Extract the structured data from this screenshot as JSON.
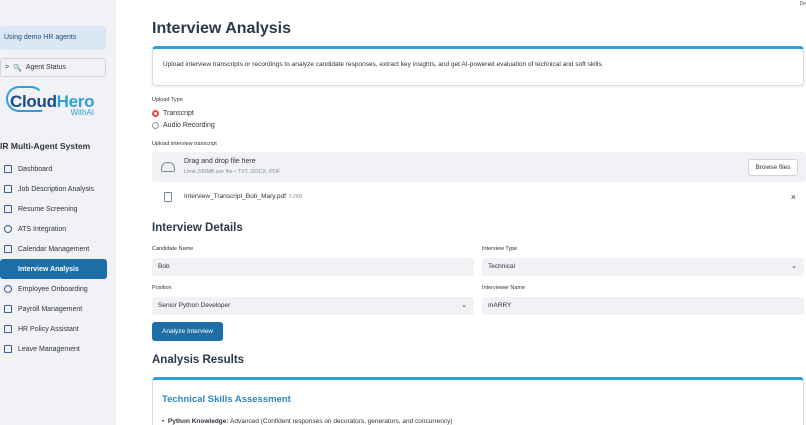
{
  "top_right": "De",
  "sidebar": {
    "demo_notice": "Using demo HR agents",
    "agent_status": {
      "chevron": ">",
      "label": "Agent Status"
    },
    "logo": {
      "brand_cloud": "Cloud",
      "brand_hero": "Hero",
      "brand_withai": "WithAI"
    },
    "system_title": "IR Multi-Agent System",
    "items": [
      {
        "label": "Dashboard",
        "icon": "home-icon",
        "active": false
      },
      {
        "label": "Job Description Analysis",
        "icon": "document-icon",
        "active": false
      },
      {
        "label": "Resume Screening",
        "icon": "resume-icon",
        "active": false
      },
      {
        "label": "ATS Integration",
        "icon": "gear-icon",
        "active": false
      },
      {
        "label": "Calendar Management",
        "icon": "calendar-icon",
        "active": false
      },
      {
        "label": "Interview Analysis",
        "icon": "interview-icon",
        "active": true
      },
      {
        "label": "Employee Onboarding",
        "icon": "user-add-icon",
        "active": false
      },
      {
        "label": "Payroll Management",
        "icon": "payroll-icon",
        "active": false
      },
      {
        "label": "HR Policy Assistant",
        "icon": "book-icon",
        "active": false
      },
      {
        "label": "Leave Management",
        "icon": "calendar-leave-icon",
        "active": false
      }
    ]
  },
  "main": {
    "title": "Interview Analysis",
    "intro": "Upload interview transcripts or recordings to analyze candidate responses, extract key insights, and get AI-powered evaluation of technical and soft skills.",
    "upload_type": {
      "label": "Upload Type",
      "options": [
        "Transcript",
        "Audio Recording"
      ],
      "selected": "Transcript"
    },
    "upload": {
      "label": "Upload interview transcript",
      "drop_title": "Drag and drop file here",
      "drop_sub": "Limit 200MB per file • TXT, DOCX, PDF",
      "browse_label": "Browse files",
      "file_name": "Interview_Transcript_Bob_Mary.pdf",
      "file_size": "3.2KB",
      "close": "×"
    },
    "details": {
      "heading": "Interview Details",
      "candidate_label": "Candidate Name",
      "candidate_value": "Bob",
      "type_label": "Interview Type",
      "type_value": "Technical",
      "position_label": "Position",
      "position_value": "Senior Python Developer",
      "interviewer_label": "Interviewer Name",
      "interviewer_value": "mARRY",
      "analyze_label": "Analyze Interview"
    },
    "results": {
      "heading": "Analysis Results",
      "card_title": "Technical Skills Assessment",
      "bullet_key": "Python Knowledge:",
      "bullet_value": " Advanced (Confident responses on decorators, generators, and concurrency)"
    }
  },
  "colors": {
    "accent": "#1e6fa8",
    "card_border": "#2e9fd8",
    "radio_on": "#e34a4a",
    "sidebar_bg": "#f0f2f6"
  }
}
